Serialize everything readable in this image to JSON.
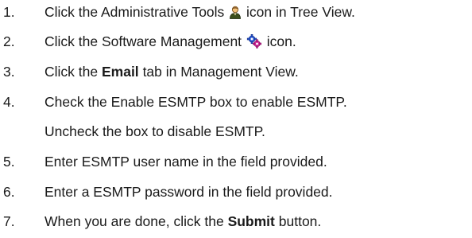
{
  "steps": [
    {
      "number": "1.",
      "parts": {
        "a": "Click the Administrative Tools",
        "icon": "admin-tools-person-icon",
        "b": "icon in Tree View."
      }
    },
    {
      "number": "2.",
      "parts": {
        "a": "Click the Software Management",
        "icon": "software-management-gears-icon",
        "b": "icon."
      }
    },
    {
      "number": "3.",
      "parts": {
        "a": "Click the",
        "bold": "Email",
        "b": "tab in Management View."
      }
    },
    {
      "number": "4.",
      "parts": {
        "a": "Check the Enable ESMTP box to enable ESMTP.",
        "continuation": "Uncheck the box to disable ESMTP."
      }
    },
    {
      "number": "5.",
      "parts": {
        "a": "Enter ESMTP user name in the field provided."
      }
    },
    {
      "number": "6.",
      "parts": {
        "a": "Enter a ESMTP password in the field provided."
      }
    },
    {
      "number": "7.",
      "parts": {
        "a": "When you are done, click the",
        "bold": "Submit",
        "b": "button."
      }
    }
  ]
}
